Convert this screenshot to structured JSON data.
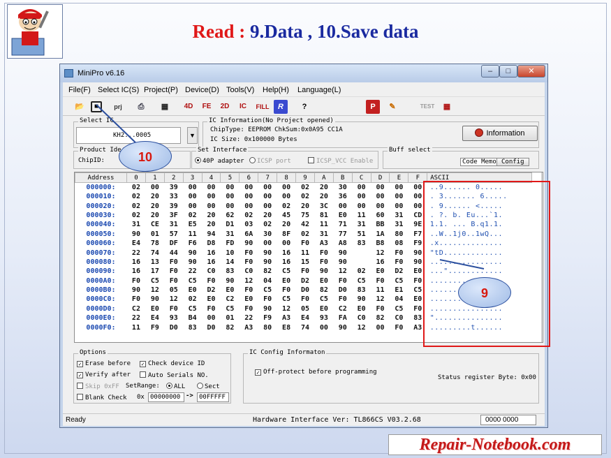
{
  "slide": {
    "title_red": "Read :",
    "title_rest": " 9.Data , 10.Save data",
    "brand": "Repair-Notebook.com"
  },
  "window": {
    "title": "MiniPro v6.16",
    "menu": [
      "File(F)",
      "Select IC(S)",
      "Project(P)",
      "Device(D)",
      "Tools(V)",
      "Help(H)",
      "Language(L)"
    ],
    "toolbar_icons": [
      "open-icon",
      "save-icon",
      "project-icon",
      "print-icon",
      "memory-icon",
      "4d-icon",
      "fe-icon",
      "2d-icon",
      "ic-icon",
      "fill-icon",
      "r-icon",
      "help-icon",
      "p-icon",
      "edit-icon",
      "test-icon",
      "chip-icon"
    ]
  },
  "select_ic": {
    "label": "Select IC",
    "value": "KH2...0005"
  },
  "ic_info": {
    "label": "IC Information(No Project opened)",
    "chiptype": "ChipType:  EEPROM    ChkSum:0x0A95 CC1A",
    "icsize": "IC Size:   0x100000 Bytes",
    "info_button": "Information"
  },
  "product": {
    "label": "Product Ide",
    "chipid": "ChipID:"
  },
  "set_interface": {
    "label": "Set Interface",
    "opt1": "40P adapter",
    "opt2": "ICSP port",
    "opt3": "ICSP_VCC Enable"
  },
  "buff": {
    "label": "Buff select",
    "code_memo": "Code Memo",
    "config": "Config"
  },
  "grid": {
    "address_header": "Address",
    "hex_headers": [
      "0",
      "1",
      "2",
      "3",
      "4",
      "5",
      "6",
      "7",
      "8",
      "9",
      "A",
      "B",
      "C",
      "D",
      "E",
      "F"
    ],
    "ascii_header": "ASCII",
    "rows": [
      {
        "addr": "000000:",
        "hex": [
          "02",
          "00",
          "39",
          "00",
          "00",
          "00",
          "00",
          "00",
          "00",
          "02",
          "20",
          "30",
          "00",
          "00",
          "00",
          "00"
        ],
        "ascii": "..9...... 0....."
      },
      {
        "addr": "000010:",
        "hex": [
          "02",
          "20",
          "33",
          "00",
          "00",
          "00",
          "00",
          "00",
          "00",
          "02",
          "20",
          "36",
          "00",
          "00",
          "00",
          "00"
        ],
        "ascii": ". 3....... 6....."
      },
      {
        "addr": "000020:",
        "hex": [
          "02",
          "20",
          "39",
          "00",
          "00",
          "00",
          "00",
          "00",
          "02",
          "20",
          "3C",
          "00",
          "00",
          "00",
          "00",
          "00"
        ],
        "ascii": ". 9...... <....."
      },
      {
        "addr": "000030:",
        "hex": [
          "02",
          "20",
          "3F",
          "02",
          "20",
          "62",
          "02",
          "20",
          "45",
          "75",
          "81",
          "E0",
          "11",
          "60",
          "31",
          "CD"
        ],
        "ascii": ". ?. b. Eu...`1."
      },
      {
        "addr": "000040:",
        "hex": [
          "31",
          "CE",
          "31",
          "E5",
          "20",
          "D1",
          "03",
          "02",
          "20",
          "42",
          "11",
          "71",
          "31",
          "BB",
          "31",
          "9E"
        ],
        "ascii": "1.1. ... B.q1.1."
      },
      {
        "addr": "000050:",
        "hex": [
          "90",
          "01",
          "57",
          "11",
          "94",
          "31",
          "6A",
          "30",
          "8F",
          "02",
          "31",
          "77",
          "51",
          "1A",
          "80",
          "F7"
        ],
        "ascii": "..W..1j0..1wQ..."
      },
      {
        "addr": "000060:",
        "hex": [
          "E4",
          "78",
          "DF",
          "F6",
          "D8",
          "FD",
          "90",
          "00",
          "00",
          "F0",
          "A3",
          "A8",
          "83",
          "B8",
          "08",
          "F9"
        ],
        "ascii": ".x.............."
      },
      {
        "addr": "000070:",
        "hex": [
          "22",
          "74",
          "44",
          "90",
          "16",
          "10",
          "F0",
          "90",
          "16",
          "11",
          "F0",
          "90",
          "",
          "12",
          "F0",
          "90"
        ],
        "ascii": "\"tD............."
      },
      {
        "addr": "000080:",
        "hex": [
          "16",
          "13",
          "F0",
          "90",
          "16",
          "14",
          "F0",
          "90",
          "16",
          "15",
          "F0",
          "90",
          "",
          "16",
          "F0",
          "90"
        ],
        "ascii": "................"
      },
      {
        "addr": "000090:",
        "hex": [
          "16",
          "17",
          "F0",
          "22",
          "C0",
          "83",
          "C0",
          "82",
          "C5",
          "F0",
          "90",
          "12",
          "02",
          "E0",
          "D2",
          "E0"
        ],
        "ascii": "...\"............"
      },
      {
        "addr": "0000A0:",
        "hex": [
          "F0",
          "C5",
          "F0",
          "C5",
          "F0",
          "90",
          "12",
          "04",
          "E0",
          "D2",
          "E0",
          "F0",
          "C5",
          "F0",
          "C5",
          "F0"
        ],
        "ascii": "................"
      },
      {
        "addr": "0000B0:",
        "hex": [
          "90",
          "12",
          "05",
          "E0",
          "D2",
          "E0",
          "F0",
          "C5",
          "F0",
          "D0",
          "82",
          "D0",
          "83",
          "11",
          "E1",
          "C5"
        ],
        "ascii": "................"
      },
      {
        "addr": "0000C0:",
        "hex": [
          "F0",
          "90",
          "12",
          "02",
          "E0",
          "C2",
          "E0",
          "F0",
          "C5",
          "F0",
          "C5",
          "F0",
          "90",
          "12",
          "04",
          "E0"
        ],
        "ascii": "................"
      },
      {
        "addr": "0000D0:",
        "hex": [
          "C2",
          "E0",
          "F0",
          "C5",
          "F0",
          "C5",
          "F0",
          "90",
          "12",
          "05",
          "E0",
          "C2",
          "E0",
          "F0",
          "C5",
          "F0"
        ],
        "ascii": "................"
      },
      {
        "addr": "0000E0:",
        "hex": [
          "22",
          "E4",
          "93",
          "B4",
          "00",
          "01",
          "22",
          "F9",
          "A3",
          "E4",
          "93",
          "FA",
          "C0",
          "82",
          "C0",
          "83"
        ],
        "ascii": "\"..............."
      },
      {
        "addr": "0000F0:",
        "hex": [
          "11",
          "F9",
          "D0",
          "83",
          "D0",
          "82",
          "A3",
          "80",
          "E8",
          "74",
          "00",
          "90",
          "12",
          "00",
          "F0",
          "A3"
        ],
        "ascii": ".........t......"
      }
    ]
  },
  "options": {
    "label": "Options",
    "erase": "Erase before",
    "check_id": "Check device ID",
    "verify": "Verify after",
    "auto_serial": "Auto Serials NO.",
    "skip": "Skip 0xFF",
    "setrange": "SetRange:",
    "all": "ALL",
    "sect": "Sect",
    "blank": "Blank Check",
    "ox": "0x",
    "start": "00000000",
    "arrow": "->",
    "end": "00FFFFF"
  },
  "ic_config": {
    "label": "IC Config Informaton",
    "off_protect": "Off-protect before programming",
    "status_reg": "Status register Byte: 0x00"
  },
  "statusbar": {
    "left": "Ready",
    "hw": "Hardware Interface Ver: TL866CS V03.2.68",
    "right": "0000 0000"
  },
  "callouts": {
    "c10": "10",
    "c9": "9"
  }
}
